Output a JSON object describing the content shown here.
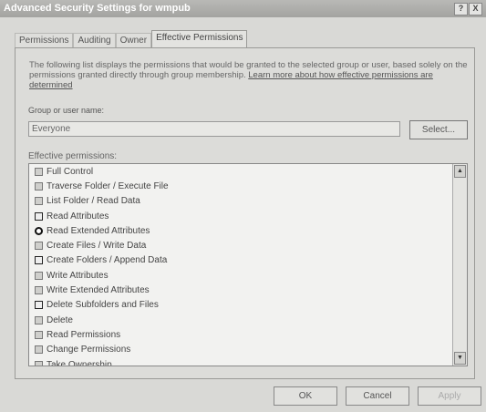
{
  "window": {
    "title": "Advanced Security Settings for wmpub",
    "help_btn": "?",
    "close_btn": "X"
  },
  "tabs": [
    {
      "label": "Permissions"
    },
    {
      "label": "Auditing"
    },
    {
      "label": "Owner"
    },
    {
      "label": "Effective Permissions"
    }
  ],
  "description": {
    "text": "The following list displays the permissions that would be granted to the selected group or user, based solely on the permissions granted directly through group membership. ",
    "link": "Learn more about how effective permissions are determined"
  },
  "group": {
    "label": "Group or user name:",
    "value": "Everyone",
    "select_label": "Select..."
  },
  "effective_permissions": {
    "label": "Effective permissions:",
    "items": [
      {
        "label": "Full Control",
        "state": "normal"
      },
      {
        "label": "Traverse Folder / Execute File",
        "state": "normal"
      },
      {
        "label": "List Folder / Read Data",
        "state": "normal"
      },
      {
        "label": "Read Attributes",
        "state": "dark"
      },
      {
        "label": "Read Extended Attributes",
        "state": "round"
      },
      {
        "label": "Create Files / Write Data",
        "state": "normal"
      },
      {
        "label": "Create Folders / Append Data",
        "state": "dark"
      },
      {
        "label": "Write Attributes",
        "state": "normal"
      },
      {
        "label": "Write Extended Attributes",
        "state": "normal"
      },
      {
        "label": "Delete Subfolders and Files",
        "state": "dark"
      },
      {
        "label": "Delete",
        "state": "normal"
      },
      {
        "label": "Read Permissions",
        "state": "normal"
      },
      {
        "label": "Change Permissions",
        "state": "normal"
      },
      {
        "label": "Take Ownership",
        "state": "normal"
      }
    ]
  },
  "footer": {
    "ok": "OK",
    "cancel": "Cancel",
    "apply": "Apply"
  }
}
